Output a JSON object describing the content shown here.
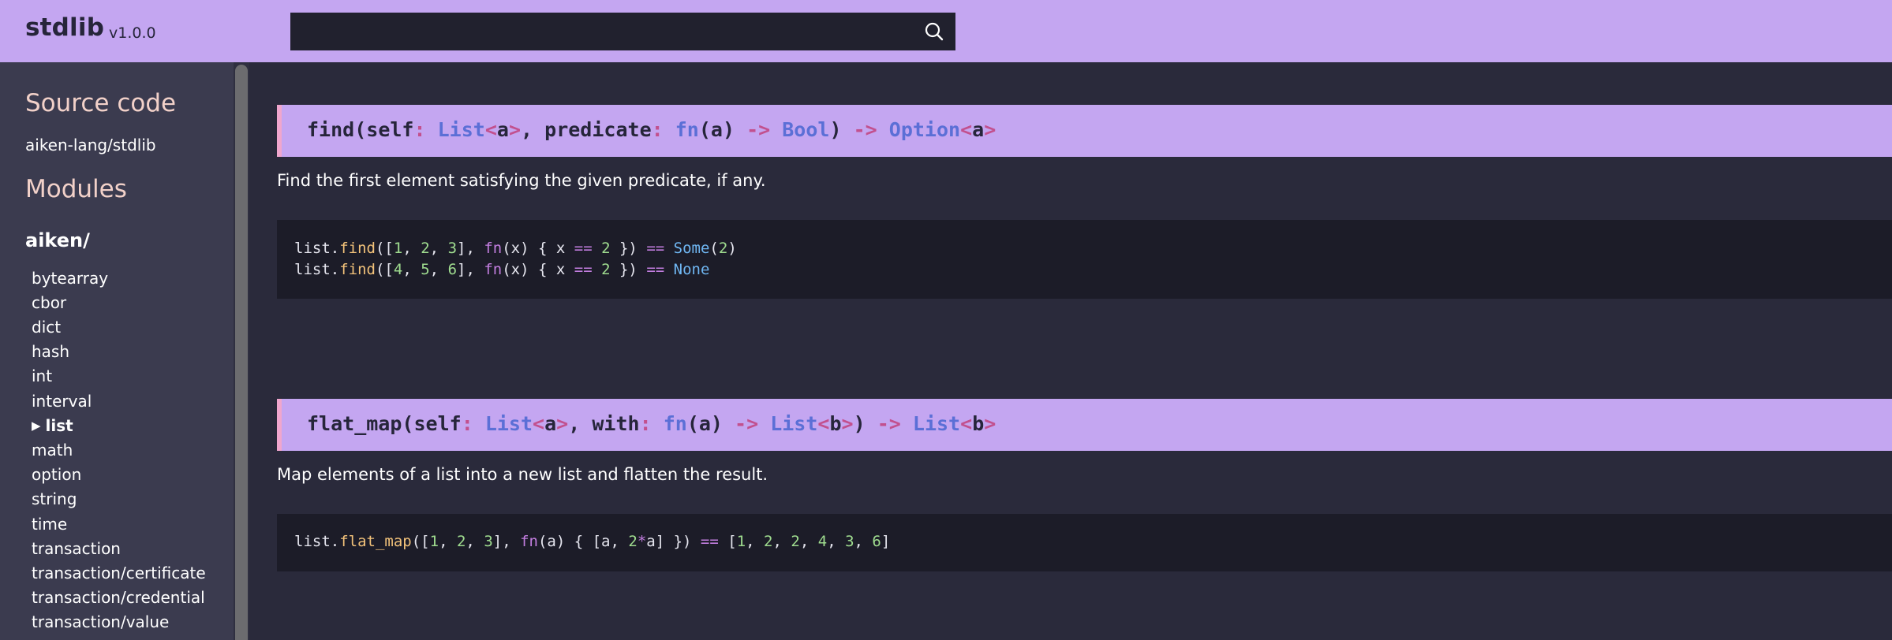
{
  "header": {
    "brand": "stdlib",
    "version": "v1.0.0",
    "search": {
      "value": "",
      "placeholder": ""
    },
    "search_icon": "search-icon"
  },
  "sidebar": {
    "source_title": "Source code",
    "source_link": "aiken-lang/stdlib",
    "modules_title": "Modules",
    "group": "aiken/",
    "active_marker": "▶",
    "modules": [
      "bytearray",
      "cbor",
      "dict",
      "hash",
      "int",
      "interval",
      "list",
      "math",
      "option",
      "string",
      "time",
      "transaction",
      "transaction/certificate",
      "transaction/credential",
      "transaction/value"
    ],
    "active_module": "list"
  },
  "functions": [
    {
      "signature": {
        "name": "find",
        "open": "(",
        "self": "self",
        "colon": ":",
        "list_type": "List",
        "lt": "<",
        "type_a": "a",
        "gt": ">",
        "comma": ",",
        "param2": "predicate",
        "fn_kw": "fn",
        "fn_args": "(a)",
        "arrow": "->",
        "bool_type": "Bool",
        "close": ")",
        "option_type": "Option"
      },
      "description": "Find the first element satisfying the given predicate, if any.",
      "code": [
        "list.find([1, 2, 3], fn(x) { x == 2 }) == Some(2)",
        "list.find([4, 5, 6], fn(x) { x == 2 }) == None"
      ]
    },
    {
      "signature": {
        "name": "flat_map",
        "open": "(",
        "self": "self",
        "colon": ":",
        "list_type": "List",
        "lt": "<",
        "type_a": "a",
        "type_b": "b",
        "gt": ">",
        "comma": ",",
        "param2": "with",
        "fn_kw": "fn",
        "fn_args": "(a)",
        "arrow": "->",
        "close": ")"
      },
      "description": "Map elements of a list into a new list and flatten the result.",
      "code": [
        "list.flat_map([1, 2, 3], fn(a) { [a, 2*a] }) == [1, 2, 2, 4, 3, 6]"
      ]
    }
  ],
  "colors": {
    "accent": "#c4a6f1",
    "sidebar_bg": "#3b3b4f",
    "main_bg": "#2a2a3b",
    "code_bg": "#1c1c28",
    "sidebar_heading": "#f2d1c9",
    "type_blue": "#5b6fd6",
    "punct_pink": "#c2508e"
  }
}
